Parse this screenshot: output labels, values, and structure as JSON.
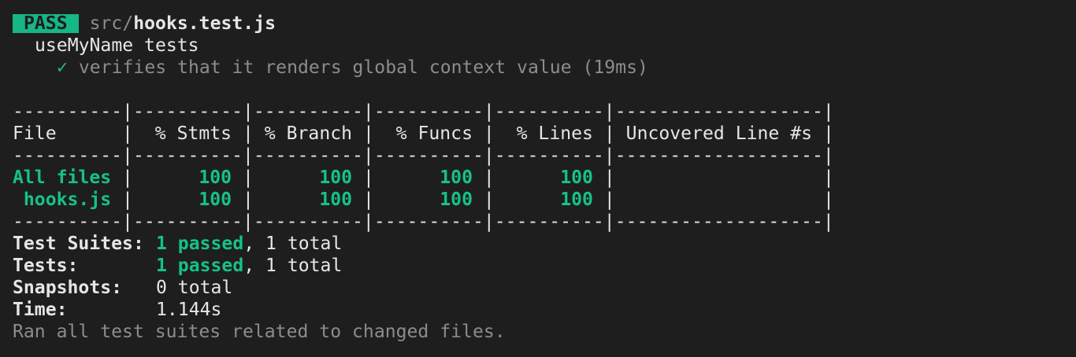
{
  "header": {
    "status_badge": "PASS",
    "file_dir": "src/",
    "file_name": "hooks.test.js"
  },
  "suite": {
    "name": "useMyName tests",
    "tests": [
      {
        "check": "✓",
        "label": "verifies that it renders global context value (19ms)"
      }
    ]
  },
  "coverage_table": {
    "separator_top": "----------|----------|----------|----------|----------|-------------------|",
    "separator": "----------|----------|----------|----------|----------|-------------------|",
    "headers": [
      "File",
      "% Stmts",
      "% Branch",
      "% Funcs",
      "% Lines",
      "Uncovered Line #s"
    ],
    "rows": [
      {
        "file": "All files",
        "stmts": "100",
        "branch": "100",
        "funcs": "100",
        "lines": "100",
        "uncovered": ""
      },
      {
        "file": " hooks.js",
        "stmts": "100",
        "branch": "100",
        "funcs": "100",
        "lines": "100",
        "uncovered": ""
      }
    ]
  },
  "summary": {
    "test_suites_label": "Test Suites:",
    "test_suites_passed": "1 passed",
    "test_suites_total": ", 1 total",
    "tests_label": "Tests:",
    "tests_passed": "1 passed",
    "tests_total": ", 1 total",
    "snapshots_label": "Snapshots:",
    "snapshots_value": "0 total",
    "time_label": "Time:",
    "time_value": "1.144s",
    "footer": "Ran all test suites related to changed files."
  },
  "colors": {
    "background": "#1e1e1e",
    "text": "#e6e6e6",
    "dim": "#8c8c8c",
    "accent_green": "#15c287"
  }
}
